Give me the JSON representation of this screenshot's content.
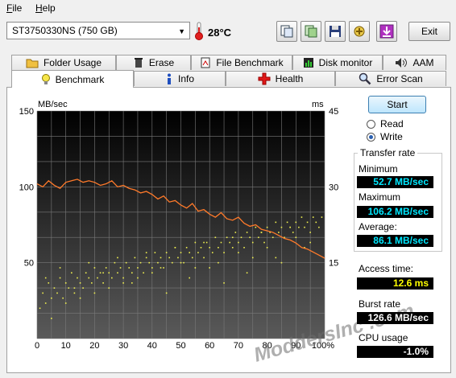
{
  "menu": {
    "file": "File",
    "help": "Help"
  },
  "toolbar": {
    "drive": "ST3750330NS (750 GB)",
    "temperature": "28°C",
    "exit_label": "Exit"
  },
  "tabs_top": [
    {
      "label": "Folder Usage",
      "icon": "folder-icon"
    },
    {
      "label": "Erase",
      "icon": "trash-icon"
    },
    {
      "label": "File Benchmark",
      "icon": "file-benchmark-icon"
    },
    {
      "label": "Disk monitor",
      "icon": "disk-monitor-icon"
    },
    {
      "label": "AAM",
      "icon": "speaker-icon"
    }
  ],
  "tabs_bottom": [
    {
      "label": "Benchmark",
      "icon": "benchmark-icon",
      "active": true
    },
    {
      "label": "Info",
      "icon": "info-icon"
    },
    {
      "label": "Health",
      "icon": "health-cross-icon"
    },
    {
      "label": "Error Scan",
      "icon": "magnifier-icon"
    }
  ],
  "side": {
    "start_label": "Start",
    "read_label": "Read",
    "write_label": "Write",
    "mode_selected": "Write",
    "transfer_rate_title": "Transfer rate",
    "minimum_label": "Minimum",
    "minimum_value": "52.7 MB/sec",
    "maximum_label": "Maximum",
    "maximum_value": "106.2 MB/sec",
    "average_label": "Average:",
    "average_value": "86.1 MB/sec",
    "access_time_label": "Access time:",
    "access_time_value": "12.6 ms",
    "burst_rate_label": "Burst rate",
    "burst_rate_value": "126.6 MB/sec",
    "cpu_usage_label": "CPU usage",
    "cpu_usage_value": "-1.0%"
  },
  "watermark": "ModdersInc .com",
  "colors": {
    "transfer_line": "#ff7a2a",
    "access_points": "#f0f050",
    "chart_bg_top": "#000000",
    "chart_bg_bottom": "#5a5a5a"
  },
  "chart_data": {
    "type": "line",
    "ylabel_left": "MB/sec",
    "ylabel_right": "ms",
    "ylim_left": [
      0,
      150
    ],
    "ylim_right": [
      0,
      45
    ],
    "yticks_left": [
      "150",
      "100",
      "50"
    ],
    "yticks_right": [
      "45",
      "30",
      "15"
    ],
    "xlim": [
      0,
      100
    ],
    "xticks": [
      "0",
      "10",
      "20",
      "30",
      "40",
      "50",
      "60",
      "70",
      "80",
      "90",
      "100%"
    ],
    "grid": true,
    "series": [
      {
        "kind": "transfer_rate_line",
        "x": [
          0,
          2,
          4,
          6,
          8,
          10,
          12,
          14,
          16,
          18,
          20,
          22,
          24,
          26,
          28,
          30,
          32,
          34,
          36,
          38,
          40,
          42,
          44,
          46,
          48,
          50,
          52,
          54,
          56,
          58,
          60,
          62,
          64,
          66,
          68,
          70,
          72,
          74,
          76,
          78,
          80,
          82,
          84,
          86,
          88,
          90,
          92,
          94,
          96,
          98,
          100
        ],
        "values": [
          102,
          100,
          104,
          101,
          99,
          103,
          104,
          105,
          103,
          104,
          103,
          101,
          102,
          104,
          100,
          101,
          99,
          98,
          96,
          97,
          95,
          92,
          94,
          90,
          91,
          88,
          86,
          89,
          84,
          85,
          82,
          80,
          83,
          79,
          78,
          80,
          76,
          74,
          75,
          72,
          71,
          70,
          68,
          66,
          65,
          63,
          60,
          59,
          57,
          55,
          53
        ]
      },
      {
        "kind": "access_time_points",
        "x": [
          1,
          2,
          3,
          4,
          5,
          6,
          7,
          8,
          9,
          10,
          11,
          12,
          13,
          14,
          15,
          16,
          17,
          18,
          19,
          20,
          21,
          22,
          23,
          24,
          25,
          26,
          27,
          28,
          29,
          30,
          31,
          32,
          33,
          34,
          35,
          36,
          37,
          38,
          39,
          40,
          41,
          42,
          43,
          44,
          45,
          46,
          47,
          48,
          49,
          50,
          51,
          52,
          53,
          54,
          55,
          56,
          57,
          58,
          59,
          60,
          61,
          62,
          63,
          64,
          65,
          66,
          67,
          68,
          69,
          70,
          71,
          72,
          73,
          74,
          75,
          76,
          77,
          78,
          79,
          80,
          81,
          82,
          83,
          84,
          85,
          86,
          87,
          88,
          89,
          90,
          91,
          92,
          93,
          94,
          95,
          96,
          97,
          98,
          99,
          3,
          8,
          13,
          18,
          23,
          28,
          33,
          38,
          43,
          48,
          53,
          58,
          63,
          68,
          73,
          78,
          83,
          88,
          93,
          5,
          15,
          25,
          35,
          45,
          55,
          65,
          75,
          85,
          95,
          10,
          20,
          30,
          40,
          50,
          60,
          70,
          80,
          90
        ],
        "values": [
          6,
          9,
          7,
          11,
          8,
          10,
          9,
          12,
          8,
          11,
          10,
          13,
          9,
          12,
          11,
          10,
          13,
          12,
          11,
          14,
          12,
          13,
          11,
          14,
          13,
          12,
          15,
          13,
          14,
          12,
          15,
          14,
          13,
          16,
          14,
          15,
          13,
          16,
          15,
          14,
          17,
          15,
          16,
          14,
          17,
          16,
          15,
          18,
          16,
          17,
          15,
          18,
          17,
          16,
          19,
          17,
          18,
          16,
          19,
          18,
          17,
          20,
          18,
          19,
          17,
          20,
          19,
          18,
          21,
          19,
          20,
          18,
          21,
          20,
          19,
          22,
          20,
          21,
          19,
          22,
          21,
          20,
          23,
          21,
          22,
          20,
          23,
          22,
          21,
          23,
          22,
          24,
          22,
          23,
          21,
          24,
          23,
          22,
          24,
          12,
          14,
          10,
          15,
          13,
          16,
          11,
          17,
          14,
          18,
          12,
          19,
          15,
          20,
          13,
          21,
          16,
          22,
          18,
          4,
          8,
          10,
          12,
          9,
          14,
          11,
          16,
          15,
          19,
          7,
          9,
          11,
          13,
          15,
          14,
          17,
          18,
          20
        ]
      }
    ]
  }
}
